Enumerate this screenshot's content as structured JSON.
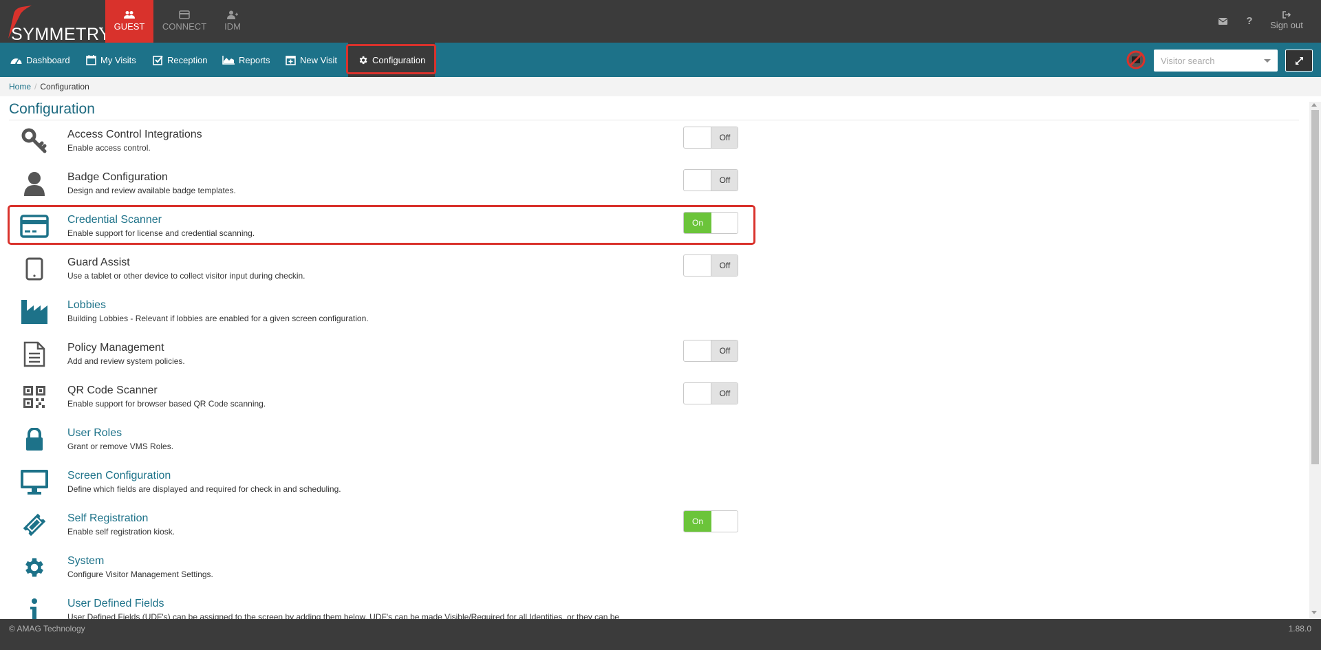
{
  "header": {
    "logo_text": "SYMMETRY",
    "logo_tm": "™",
    "apps": [
      {
        "label": "GUEST",
        "icon": "users-icon",
        "active": true
      },
      {
        "label": "CONNECT",
        "icon": "card-icon",
        "active": false
      },
      {
        "label": "IDM",
        "icon": "user-plus-icon",
        "active": false
      }
    ],
    "help_label": "?",
    "signout_label": "Sign out"
  },
  "nav": {
    "items": [
      {
        "label": "Dashboard",
        "icon": "dashboard-icon"
      },
      {
        "label": "My Visits",
        "icon": "calendar-icon"
      },
      {
        "label": "Reception",
        "icon": "check-square-icon"
      },
      {
        "label": "Reports",
        "icon": "area-chart-icon"
      },
      {
        "label": "New Visit",
        "icon": "calendar-plus-icon"
      },
      {
        "label": "Configuration",
        "icon": "gear-icon"
      }
    ],
    "search_placeholder": "Visitor search"
  },
  "breadcrumb": {
    "home": "Home",
    "separator": "/",
    "current": "Configuration"
  },
  "page_title": "Configuration",
  "config_items": [
    {
      "title": "Access Control Integrations",
      "desc": "Enable access control.",
      "icon": "key-icon",
      "toggle": "Off",
      "link": false
    },
    {
      "title": "Badge Configuration",
      "desc": "Design and review available badge templates.",
      "icon": "user-icon",
      "toggle": "Off",
      "link": false
    },
    {
      "title": "Credential Scanner",
      "desc": "Enable support for license and credential scanning.",
      "icon": "credit-card-icon",
      "toggle": "On",
      "link": true
    },
    {
      "title": "Guard Assist",
      "desc": "Use a tablet or other device to collect visitor input during checkin.",
      "icon": "tablet-icon",
      "toggle": "Off",
      "link": false
    },
    {
      "title": "Lobbies",
      "desc": "Building Lobbies - Relevant if lobbies are enabled for a given screen configuration.",
      "icon": "factory-icon",
      "toggle": null,
      "link": true
    },
    {
      "title": "Policy Management",
      "desc": "Add and review system policies.",
      "icon": "document-icon",
      "toggle": "Off",
      "link": false
    },
    {
      "title": "QR Code Scanner",
      "desc": "Enable support for browser based QR Code scanning.",
      "icon": "qr-code-icon",
      "toggle": "Off",
      "link": false
    },
    {
      "title": "User Roles",
      "desc": "Grant or remove VMS Roles.",
      "icon": "lock-icon",
      "toggle": null,
      "link": true
    },
    {
      "title": "Screen Configuration",
      "desc": "Define which fields are displayed and required for check in and scheduling.",
      "icon": "monitor-icon",
      "toggle": null,
      "link": true
    },
    {
      "title": "Self Registration",
      "desc": "Enable self registration kiosk.",
      "icon": "ticket-icon",
      "toggle": "On",
      "link": true
    },
    {
      "title": "System",
      "desc": "Configure Visitor Management Settings.",
      "icon": "gear-icon",
      "toggle": null,
      "link": true
    },
    {
      "title": "User Defined Fields",
      "desc": "User Defined Fields (UDF's) can be assigned to the screen by adding them below. UDF's can be made Visible/Required for all Identities, or they can be",
      "icon": "info-icon",
      "toggle": null,
      "link": true
    }
  ],
  "footer": {
    "copyright": "© AMAG Technology",
    "version": "1.88.0"
  },
  "colors": {
    "brand_red": "#d9322c",
    "nav_teal": "#1d7289",
    "toggle_on": "#6bc43a",
    "dark": "#3b3b3b"
  }
}
